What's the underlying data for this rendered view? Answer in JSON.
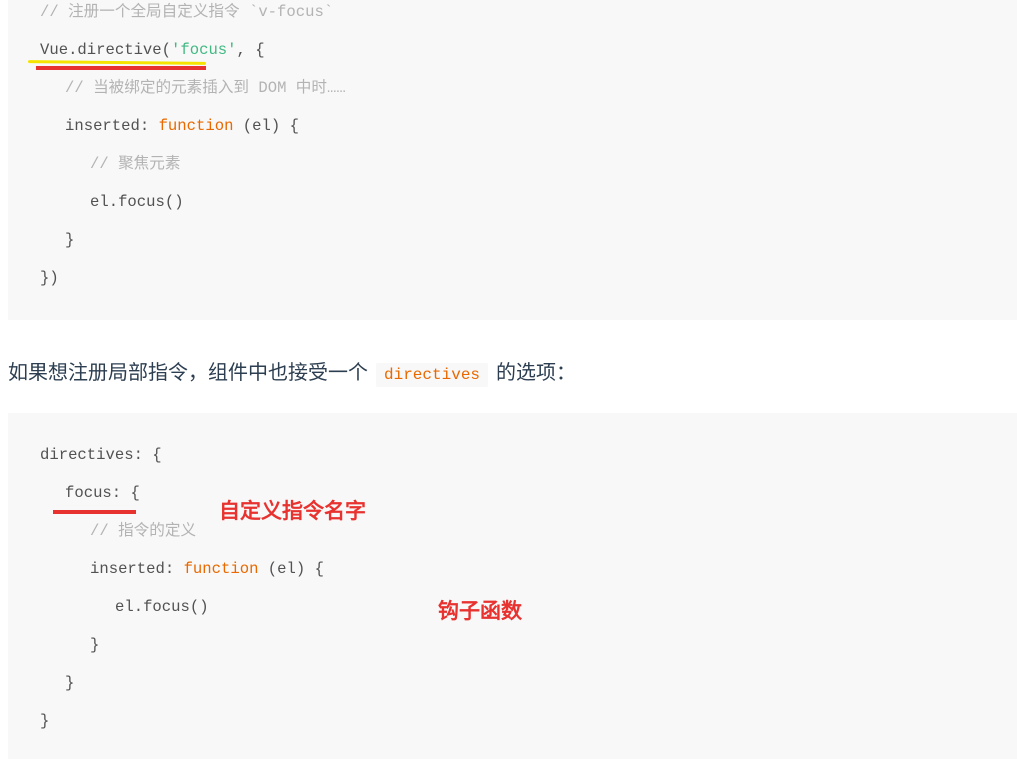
{
  "code_block_1": {
    "lines": [
      {
        "indent": 0,
        "parts": [
          {
            "t": "// 注册一个全局自定义指令 `v-focus`",
            "c": "cm"
          }
        ]
      },
      {
        "indent": 0,
        "parts": [
          {
            "t": "Vue.directive(",
            "c": ""
          },
          {
            "t": "'focus'",
            "c": "st"
          },
          {
            "t": ", {",
            "c": ""
          }
        ]
      },
      {
        "indent": 1,
        "parts": [
          {
            "t": "// 当被绑定的元素插入到 DOM 中时……",
            "c": "cm"
          }
        ]
      },
      {
        "indent": 1,
        "parts": [
          {
            "t": "inserted: ",
            "c": ""
          },
          {
            "t": "function",
            "c": "kw"
          },
          {
            "t": " (el) {",
            "c": ""
          }
        ]
      },
      {
        "indent": 2,
        "parts": [
          {
            "t": "// 聚焦元素",
            "c": "cm"
          }
        ]
      },
      {
        "indent": 2,
        "parts": [
          {
            "t": "el.focus()",
            "c": ""
          }
        ]
      },
      {
        "indent": 1,
        "parts": [
          {
            "t": "}",
            "c": ""
          }
        ]
      },
      {
        "indent": 0,
        "parts": [
          {
            "t": "})",
            "c": ""
          }
        ]
      }
    ]
  },
  "paragraph": {
    "before": "如果想注册局部指令，组件中也接受一个",
    "code": "directives",
    "after": "的选项："
  },
  "code_block_2": {
    "lines": [
      {
        "indent": 0,
        "parts": [
          {
            "t": "directives: {",
            "c": ""
          }
        ]
      },
      {
        "indent": 1,
        "parts": [
          {
            "t": "focus: {",
            "c": ""
          }
        ]
      },
      {
        "indent": 2,
        "parts": [
          {
            "t": "// 指令的定义",
            "c": "cm"
          }
        ]
      },
      {
        "indent": 2,
        "parts": [
          {
            "t": "inserted: ",
            "c": ""
          },
          {
            "t": "function",
            "c": "kw"
          },
          {
            "t": " (el) {",
            "c": ""
          }
        ]
      },
      {
        "indent": 3,
        "parts": [
          {
            "t": "el.focus()",
            "c": ""
          }
        ]
      },
      {
        "indent": 2,
        "parts": [
          {
            "t": "}",
            "c": ""
          }
        ]
      },
      {
        "indent": 1,
        "parts": [
          {
            "t": "}",
            "c": ""
          }
        ]
      },
      {
        "indent": 0,
        "parts": [
          {
            "t": "}",
            "c": ""
          }
        ]
      }
    ]
  },
  "annotations": {
    "directive_name": "自定义指令名字",
    "hook_function": "钩子函数"
  },
  "colors": {
    "annotation_red": "#e8322f",
    "highlight_yellow": "#f5e400",
    "keyword": "#e96900",
    "string": "#42b983",
    "comment": "#b3b3b3"
  }
}
